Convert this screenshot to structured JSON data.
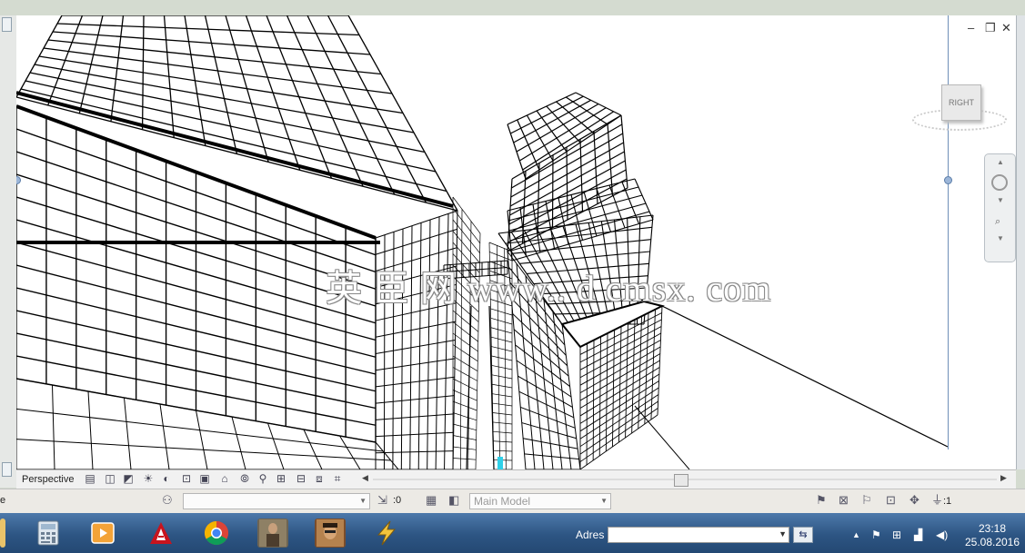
{
  "viewport": {
    "view_name": "Perspective",
    "watermark": "英 臣 网 www.. d cmsx. com"
  },
  "view_cube": {
    "face_label": "RIGHT"
  },
  "window_controls": {
    "minimize": "‒",
    "restore": "❐",
    "close": "✕"
  },
  "status_bar": {
    "workset_value": "",
    "editable_only": ":0",
    "design_option": "Main Model",
    "filter_count": ":1"
  },
  "taskbar": {
    "apps": [
      {
        "name": "calculator"
      },
      {
        "name": "media-player"
      },
      {
        "name": "autodesk"
      },
      {
        "name": "chrome"
      },
      {
        "name": "game-1"
      },
      {
        "name": "game-2"
      },
      {
        "name": "winamp"
      }
    ],
    "address_label": "Adres",
    "address_value": "",
    "time": "23:18",
    "date": "25.08.2016"
  },
  "colors": {
    "taskbar": "#2d5583",
    "viewport_bg": "#ffffff",
    "line": "#000000"
  }
}
